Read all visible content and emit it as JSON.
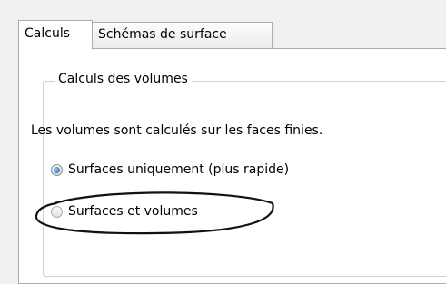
{
  "tabs": [
    {
      "label": "Calculs",
      "active": true
    },
    {
      "label": "Schémas de surface",
      "active": false
    }
  ],
  "group": {
    "title": "Calculs des volumes",
    "description": "Les volumes sont calculés sur les faces finies.",
    "options": [
      {
        "label": "Surfaces uniquement (plus rapide)",
        "checked": true
      },
      {
        "label": "Surfaces et volumes",
        "checked": false
      }
    ]
  },
  "annotation": {
    "shape": "ellipse",
    "color": "#000000",
    "target": "Surfaces et volumes"
  }
}
